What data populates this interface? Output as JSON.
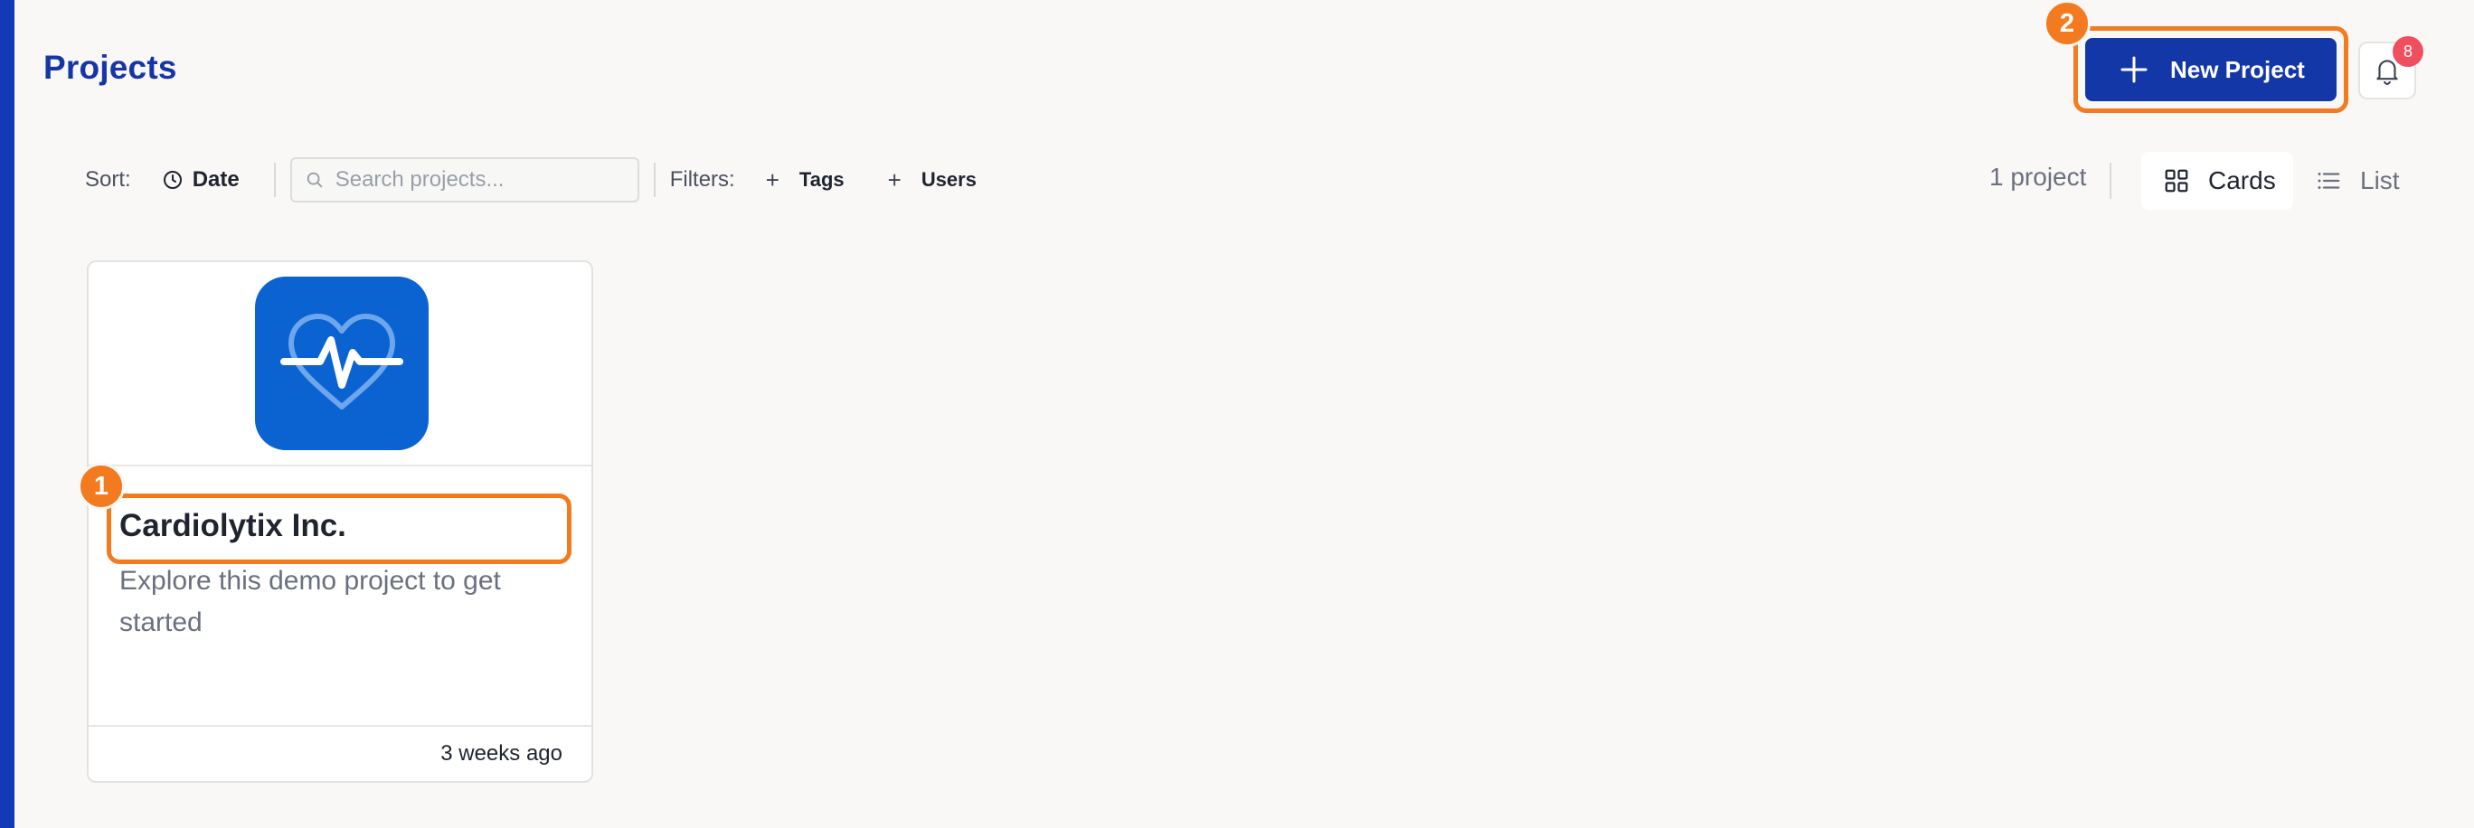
{
  "header": {
    "title": "Projects",
    "new_project_label": "New Project",
    "notification_count": "8"
  },
  "annotations": {
    "step1": "1",
    "step2": "2"
  },
  "toolbar": {
    "sort_label": "Sort:",
    "sort_value": "Date",
    "search_placeholder": "Search projects...",
    "filters_label": "Filters:",
    "filter_tags": "Tags",
    "filter_users": "Users",
    "project_count": "1 project",
    "view_cards": "Cards",
    "view_list": "List"
  },
  "projects": [
    {
      "name": "Cardiolytix Inc.",
      "description": "Explore this demo project to get started",
      "updated": "3 weeks ago",
      "icon": "heart-pulse-icon"
    }
  ],
  "colors": {
    "brand": "#1437a8",
    "highlight": "#f47a1f",
    "badge": "#ef4f5f",
    "app_icon": "#0a63d1"
  }
}
